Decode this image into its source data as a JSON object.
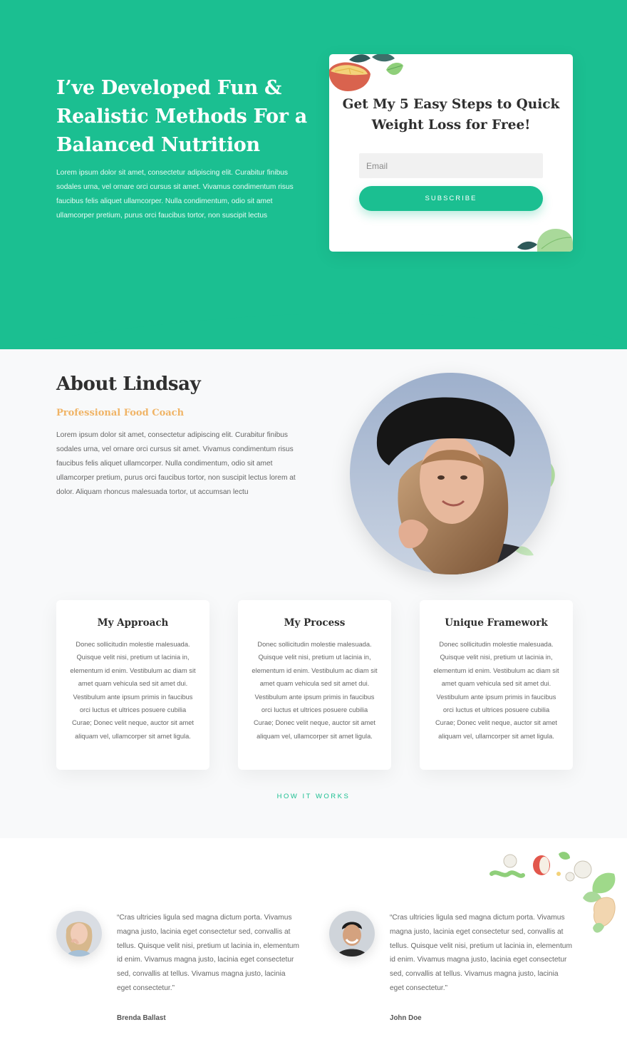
{
  "hero": {
    "title": "I’ve Developed Fun & Realistic Methods For a Balanced Nutrition",
    "text": "Lorem ipsum dolor sit amet, consectetur adipiscing elit. Curabitur finibus sodales urna, vel ornare orci cursus sit amet. Vivamus condimentum risus faucibus felis aliquet ullamcorper. Nulla condimentum, odio sit amet ullamcorper pretium, purus orci faucibus tortor, non suscipit lectus"
  },
  "signup": {
    "title": "Get My 5 Easy Steps to Quick Weight Loss for Free!",
    "email_placeholder": "Email",
    "subscribe_label": "SUBSCRIBE"
  },
  "about": {
    "title": "About Lindsay",
    "subtitle": "Professional Food Coach",
    "text": "Lorem ipsum dolor sit amet, consectetur adipiscing elit. Curabitur finibus sodales urna, vel ornare orci cursus sit amet. Vivamus condimentum risus faucibus felis aliquet ullamcorper. Nulla condimentum, odio sit amet ullamcorper pretium, purus orci faucibus tortor, non suscipit lectus lorem at dolor. Aliquam rhoncus malesuada tortor, ut accumsan lectu"
  },
  "features": [
    {
      "title": "My Approach",
      "text": "Donec sollicitudin molestie malesuada. Quisque velit nisi, pretium ut lacinia in, elementum id enim. Vestibulum ac diam sit amet quam vehicula sed sit amet dui. Vestibulum ante ipsum primis in faucibus orci luctus et ultrices posuere cubilia Curae; Donec velit neque, auctor sit amet aliquam vel, ullamcorper sit amet ligula."
    },
    {
      "title": "My Process",
      "text": "Donec sollicitudin molestie malesuada. Quisque velit nisi, pretium ut lacinia in, elementum id enim. Vestibulum ac diam sit amet quam vehicula sed sit amet dui. Vestibulum ante ipsum primis in faucibus orci luctus et ultrices posuere cubilia Curae; Donec velit neque, auctor sit amet aliquam vel, ullamcorper sit amet ligula."
    },
    {
      "title": "Unique Framework",
      "text": "Donec sollicitudin molestie malesuada. Quisque velit nisi, pretium ut lacinia in, elementum id enim. Vestibulum ac diam sit amet quam vehicula sed sit amet dui. Vestibulum ante ipsum primis in faucibus orci luctus et ultrices posuere cubilia Curae; Donec velit neque, auctor sit amet aliquam vel, ullamcorper sit amet ligula."
    }
  ],
  "how_it_works_label": "HOW IT WORKS",
  "testimonials": [
    {
      "quote": "“Cras ultricies ligula sed magna dictum porta. Vivamus magna justo, lacinia eget consectetur sed, convallis at tellus. Quisque velit nisi, pretium ut lacinia in, elementum id enim. Vivamus magna justo, lacinia eget consectetur sed, convallis at tellus. Vivamus magna justo, lacinia eget consectetur.”",
      "name": "Brenda Ballast"
    },
    {
      "quote": "“Cras ultricies ligula sed magna dictum porta. Vivamus magna justo, lacinia eget consectetur sed, convallis at tellus. Quisque velit nisi, pretium ut lacinia in, elementum id enim. Vivamus magna justo, lacinia eget consectetur sed, convallis at tellus. Vivamus magna justo, lacinia eget consectetur.”",
      "name": "John Doe"
    }
  ],
  "colors": {
    "brand_green": "#1bbf91",
    "accent_orange": "#f0b466",
    "heading_dark": "#2f2f2f",
    "page_bg": "#f8f9fa"
  },
  "icons": {
    "signup_deco_top": "citrus-leaf-illustration",
    "signup_deco_bottom": "leaf-illustration",
    "food_deco": "vegetables-illustration"
  }
}
